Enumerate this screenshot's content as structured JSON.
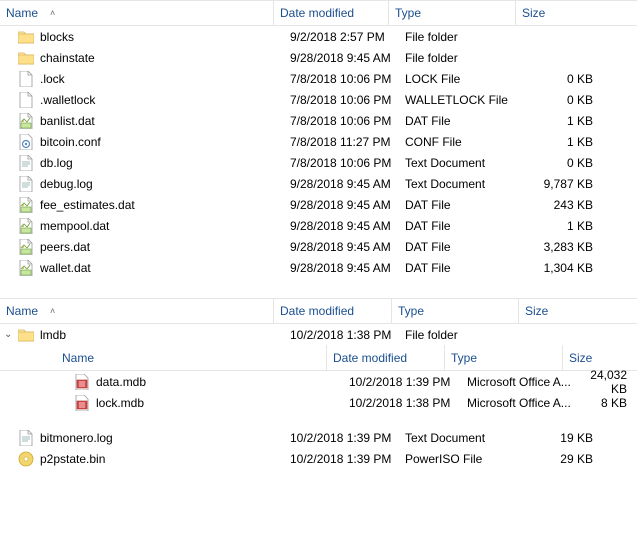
{
  "headers": {
    "name": "Name",
    "date": "Date modified",
    "type": "Type",
    "size": "Size"
  },
  "paneA": {
    "items": [
      {
        "icon": "folder",
        "name": "blocks",
        "date": "9/2/2018 2:57 PM",
        "type": "File folder",
        "size": ""
      },
      {
        "icon": "folder",
        "name": "chainstate",
        "date": "9/28/2018 9:45 AM",
        "type": "File folder",
        "size": ""
      },
      {
        "icon": "file",
        "name": ".lock",
        "date": "7/8/2018 10:06 PM",
        "type": "LOCK File",
        "size": "0 KB"
      },
      {
        "icon": "file",
        "name": ".walletlock",
        "date": "7/8/2018 10:06 PM",
        "type": "WALLETLOCK File",
        "size": "0 KB"
      },
      {
        "icon": "dat",
        "name": "banlist.dat",
        "date": "7/8/2018 10:06 PM",
        "type": "DAT File",
        "size": "1 KB"
      },
      {
        "icon": "conf",
        "name": "bitcoin.conf",
        "date": "7/8/2018 11:27 PM",
        "type": "CONF File",
        "size": "1 KB"
      },
      {
        "icon": "text",
        "name": "db.log",
        "date": "7/8/2018 10:06 PM",
        "type": "Text Document",
        "size": "0 KB"
      },
      {
        "icon": "text",
        "name": "debug.log",
        "date": "9/28/2018 9:45 AM",
        "type": "Text Document",
        "size": "9,787 KB"
      },
      {
        "icon": "dat",
        "name": "fee_estimates.dat",
        "date": "9/28/2018 9:45 AM",
        "type": "DAT File",
        "size": "243 KB"
      },
      {
        "icon": "dat",
        "name": "mempool.dat",
        "date": "9/28/2018 9:45 AM",
        "type": "DAT File",
        "size": "1 KB"
      },
      {
        "icon": "dat",
        "name": "peers.dat",
        "date": "9/28/2018 9:45 AM",
        "type": "DAT File",
        "size": "3,283 KB"
      },
      {
        "icon": "dat",
        "name": "wallet.dat",
        "date": "9/28/2018 9:45 AM",
        "type": "DAT File",
        "size": "1,304 KB"
      }
    ]
  },
  "paneB": {
    "items": [
      {
        "icon": "folder",
        "name": "lmdb",
        "date": "10/2/2018 1:38 PM",
        "type": "File folder",
        "size": "",
        "expanded": true,
        "children": [
          {
            "icon": "mdb",
            "name": "data.mdb",
            "date": "10/2/2018 1:39 PM",
            "type": "Microsoft Office A...",
            "size": "24,032 KB"
          },
          {
            "icon": "mdb",
            "name": "lock.mdb",
            "date": "10/2/2018 1:38 PM",
            "type": "Microsoft Office A...",
            "size": "8 KB"
          }
        ]
      },
      {
        "icon": "text",
        "name": "bitmonero.log",
        "date": "10/2/2018 1:39 PM",
        "type": "Text Document",
        "size": "19 KB"
      },
      {
        "icon": "iso",
        "name": "p2pstate.bin",
        "date": "10/2/2018 1:39 PM",
        "type": "PowerISO File",
        "size": "29 KB"
      }
    ]
  }
}
